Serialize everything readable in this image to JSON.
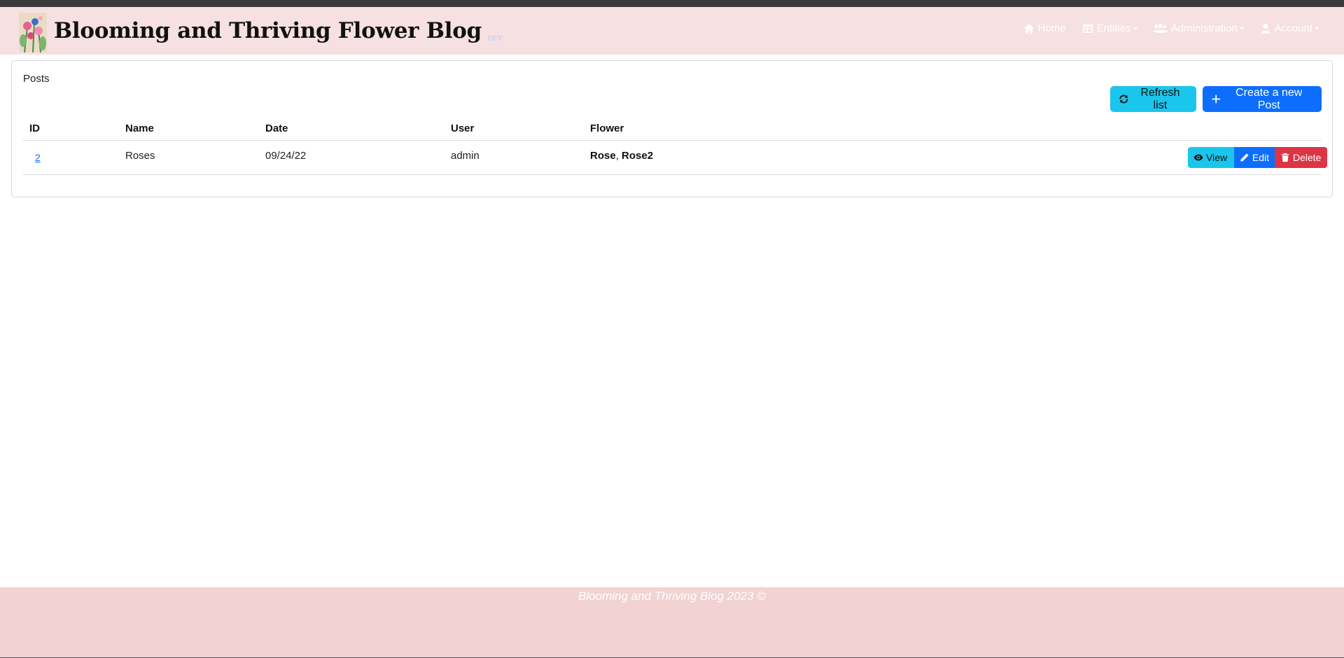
{
  "navbar": {
    "brand_title": "Blooming and Thriving Flower Blog",
    "env_badge": "DEV",
    "items": [
      {
        "label": "Home",
        "icon": "home-icon",
        "dropdown": false
      },
      {
        "label": "Entities",
        "icon": "table-icon",
        "dropdown": true
      },
      {
        "label": "Administration",
        "icon": "users-cog-icon",
        "dropdown": true
      },
      {
        "label": "Account",
        "icon": "user-icon",
        "dropdown": true
      }
    ]
  },
  "page": {
    "title": "Posts",
    "refresh_label": "Refresh list",
    "create_label": "Create a new Post"
  },
  "table": {
    "headers": [
      "ID",
      "Name",
      "Date",
      "User",
      "Flower"
    ],
    "rows": [
      {
        "id": "2",
        "name": "Roses",
        "date": "09/24/22",
        "user": "admin",
        "flowers": [
          "Rose",
          "Rose2"
        ],
        "flower_sep": ", ",
        "actions": {
          "view": "View",
          "edit": "Edit",
          "delete": "Delete"
        }
      }
    ]
  },
  "footer": {
    "text": "Blooming and Thriving Blog 2023 ©"
  },
  "colors": {
    "navbar_bg": "#f6e0e2",
    "footer_bg": "#f2d2d3",
    "info": "#1ac6ec",
    "primary": "#0d6efd",
    "danger": "#dc3545"
  }
}
